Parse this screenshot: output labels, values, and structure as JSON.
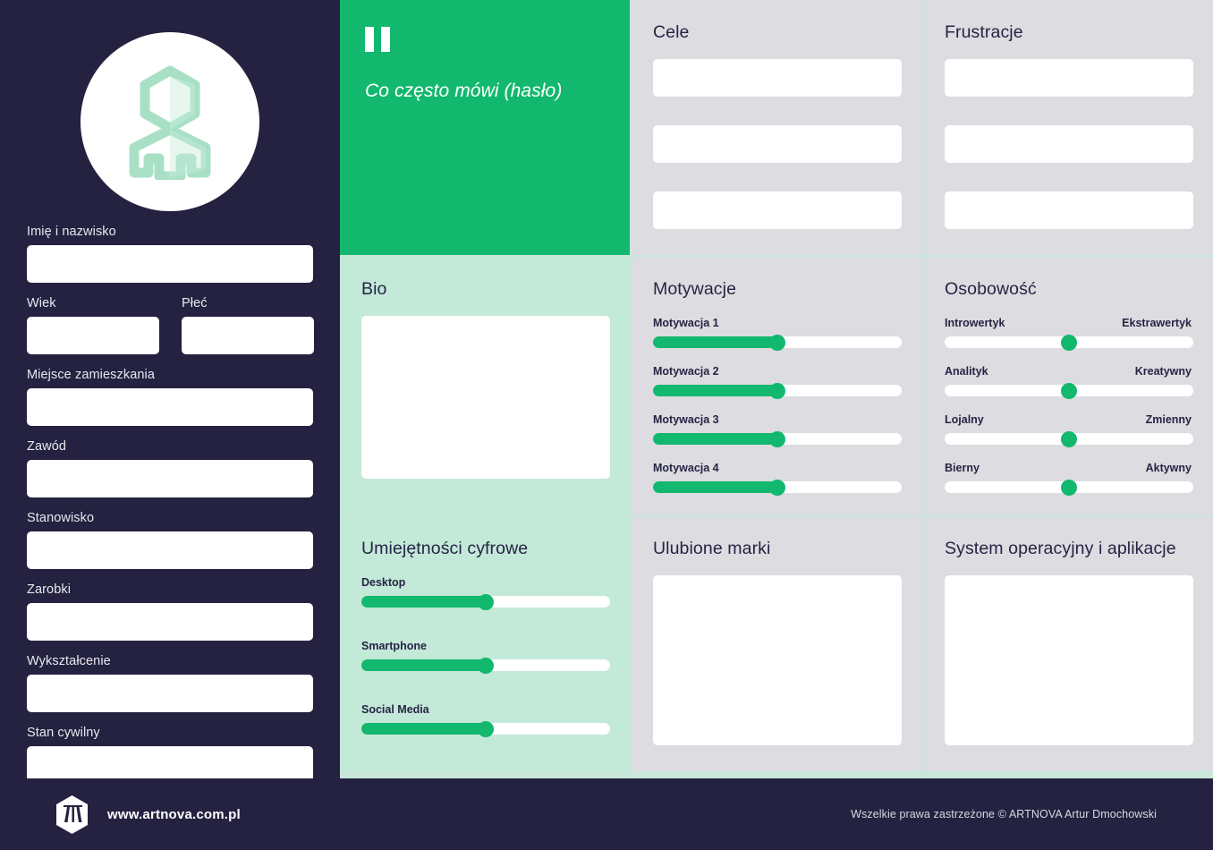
{
  "theme": {
    "dark": "#242240",
    "green": "#12b86d",
    "mint": "#c3e9d8",
    "gray": "#dcdce1",
    "white": "#ffffff"
  },
  "sidebar": {
    "avatar_icon": "person-hexagon-icon",
    "fields": [
      {
        "label": "Imię i nazwisko",
        "value": "",
        "placeholder": ""
      },
      {
        "label": "Wiek",
        "value": "",
        "placeholder": ""
      },
      {
        "label": "Płeć",
        "value": "",
        "placeholder": ""
      },
      {
        "label": "Miejsce zamieszkania",
        "value": "",
        "placeholder": ""
      },
      {
        "label": "Zawód",
        "value": "",
        "placeholder": ""
      },
      {
        "label": "Stanowisko",
        "value": "",
        "placeholder": ""
      },
      {
        "label": "Zarobki",
        "value": "",
        "placeholder": ""
      },
      {
        "label": "Wykształcenie",
        "value": "",
        "placeholder": ""
      },
      {
        "label": "Stan cywilny",
        "value": "",
        "placeholder": ""
      }
    ]
  },
  "quote": {
    "icon": "quote-mark-icon",
    "text": "Co często mówi (hasło)"
  },
  "goals": {
    "title": "Cele",
    "items": [
      {
        "value": ""
      },
      {
        "value": ""
      },
      {
        "value": ""
      }
    ]
  },
  "frustrations": {
    "title": "Frustracje",
    "items": [
      {
        "value": ""
      },
      {
        "value": ""
      },
      {
        "value": ""
      }
    ]
  },
  "bio": {
    "title": "Bio",
    "value": ""
  },
  "motivations": {
    "title": "Motywacje",
    "sliders": [
      {
        "label": "Motywacja 1",
        "value": 50
      },
      {
        "label": "Motywacja 2",
        "value": 50
      },
      {
        "label": "Motywacja 3",
        "value": 50
      },
      {
        "label": "Motywacja 4",
        "value": 50
      }
    ]
  },
  "personality": {
    "title": "Osobowość",
    "sliders": [
      {
        "left": "Introwertyk",
        "right": "Ekstrawertyk",
        "value": 50
      },
      {
        "left": "Analityk",
        "right": "Kreatywny",
        "value": 50
      },
      {
        "left": "Lojalny",
        "right": "Zmienny",
        "value": 50
      },
      {
        "left": "Bierny",
        "right": "Aktywny",
        "value": 50
      }
    ]
  },
  "digital_skills": {
    "title": "Umiejętności cyfrowe",
    "sliders": [
      {
        "label": "Desktop",
        "value": 50
      },
      {
        "label": "Smartphone",
        "value": 50
      },
      {
        "label": "Social Media",
        "value": 50
      }
    ]
  },
  "brands": {
    "title": "Ulubione marki",
    "value": ""
  },
  "os_apps": {
    "title": "System operacyjny i aplikacje",
    "value": ""
  },
  "footer": {
    "logo_icon": "artnova-hexagon-logo-icon",
    "url": "www.artnova.com.pl",
    "copyright": "Wszelkie prawa zastrzeżone © ARTNOVA Artur Dmochowski"
  }
}
